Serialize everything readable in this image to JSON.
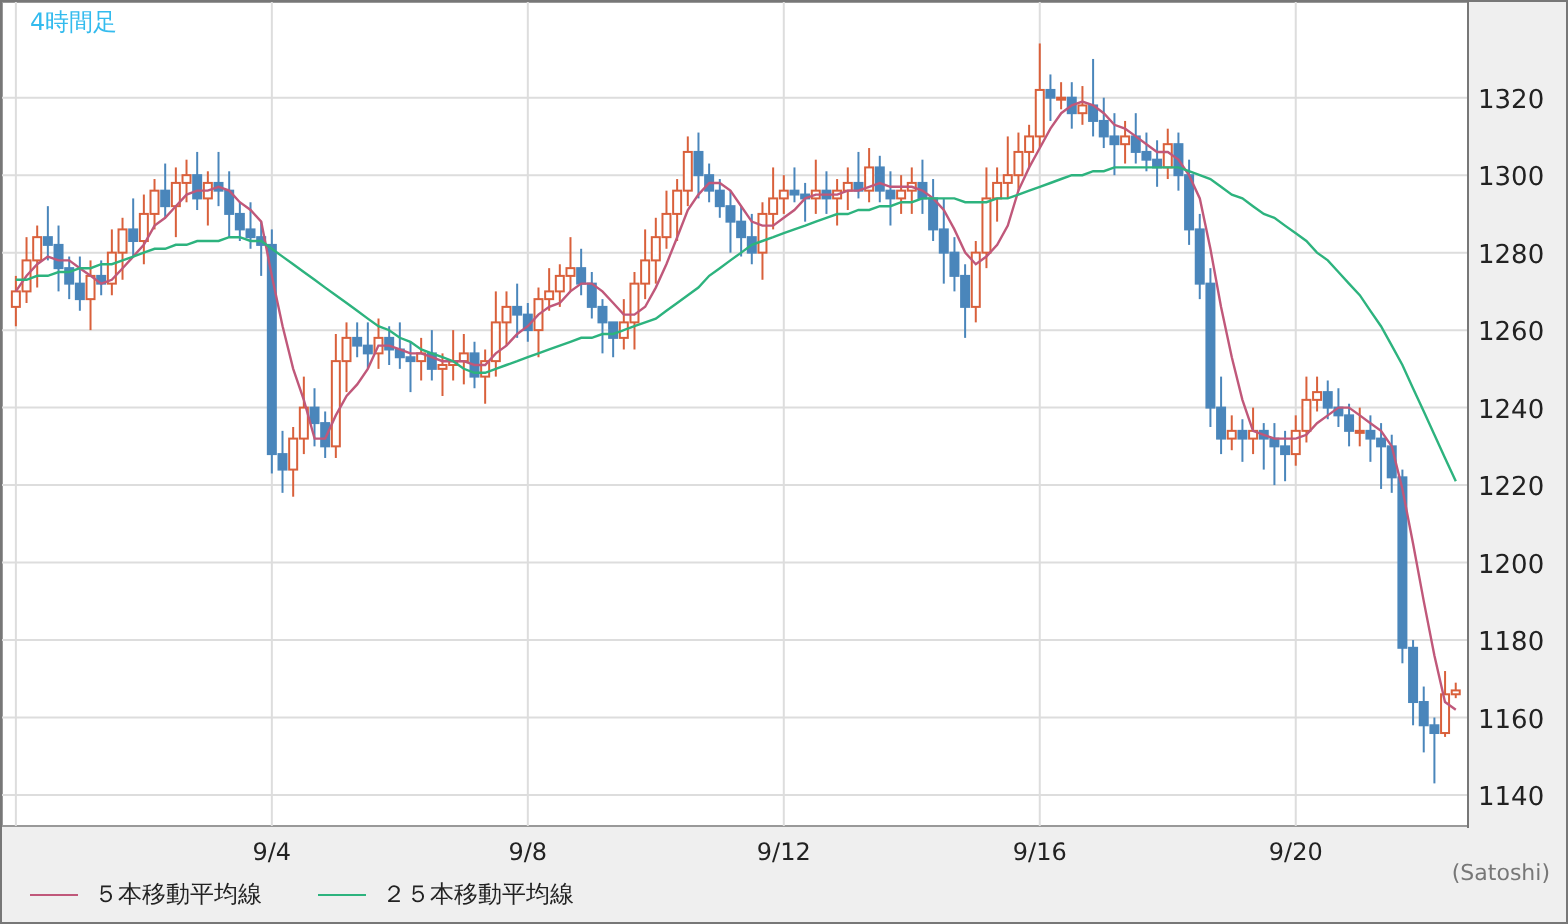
{
  "title": "4時間足",
  "chart_data": {
    "type": "candlestick",
    "grid": true,
    "ylim": [
      1132,
      1344.7
    ],
    "categories": [
      null,
      null,
      null,
      null,
      null,
      null,
      null,
      null,
      null,
      null,
      null,
      null,
      null,
      null,
      null,
      null,
      null,
      null,
      null,
      null,
      null,
      null,
      null,
      null,
      "9/4",
      null,
      null,
      null,
      null,
      null,
      null,
      null,
      null,
      null,
      null,
      null,
      null,
      null,
      null,
      null,
      null,
      null,
      null,
      null,
      null,
      null,
      null,
      null,
      "9/8",
      null,
      null,
      null,
      null,
      null,
      null,
      null,
      null,
      null,
      null,
      null,
      null,
      null,
      null,
      null,
      null,
      null,
      null,
      null,
      null,
      null,
      null,
      null,
      "9/12",
      null,
      null,
      null,
      null,
      null,
      null,
      null,
      null,
      null,
      null,
      null,
      null,
      null,
      null,
      null,
      null,
      null,
      null,
      null,
      null,
      null,
      null,
      null,
      "9/16",
      null,
      null,
      null,
      null,
      null,
      null,
      null,
      null,
      null,
      null,
      null,
      null,
      null,
      null,
      null,
      null,
      null,
      null,
      null,
      null,
      null,
      null,
      null,
      "9/20",
      null,
      null,
      null,
      null,
      null,
      null,
      null,
      null,
      null,
      null,
      null,
      null,
      null,
      null,
      null
    ],
    "yticks": [
      1140,
      1160,
      1180,
      1200,
      1220,
      1240,
      1260,
      1280,
      1300,
      1320
    ],
    "ohlc": [
      [
        1266,
        1274,
        1261,
        1270
      ],
      [
        1270,
        1284,
        1267,
        1278
      ],
      [
        1278,
        1287,
        1271,
        1284
      ],
      [
        1284,
        1292,
        1278,
        1282
      ],
      [
        1282,
        1287,
        1270,
        1276
      ],
      [
        1276,
        1279,
        1268,
        1272
      ],
      [
        1272,
        1279,
        1265,
        1268
      ],
      [
        1268,
        1278,
        1260,
        1274
      ],
      [
        1274,
        1278,
        1269,
        1272
      ],
      [
        1272,
        1286,
        1269,
        1280
      ],
      [
        1280,
        1289,
        1273,
        1286
      ],
      [
        1286,
        1294,
        1279,
        1283
      ],
      [
        1283,
        1295,
        1277,
        1290
      ],
      [
        1290,
        1299,
        1286,
        1296
      ],
      [
        1296,
        1303,
        1289,
        1292
      ],
      [
        1292,
        1302,
        1284,
        1298
      ],
      [
        1298,
        1304,
        1293,
        1300
      ],
      [
        1300,
        1306,
        1291,
        1294
      ],
      [
        1294,
        1301,
        1287,
        1298
      ],
      [
        1298,
        1306,
        1292,
        1296
      ],
      [
        1296,
        1301,
        1284,
        1290
      ],
      [
        1290,
        1293,
        1283,
        1286
      ],
      [
        1286,
        1293,
        1281,
        1284
      ],
      [
        1284,
        1288,
        1274,
        1282
      ],
      [
        1282,
        1286,
        1223,
        1228
      ],
      [
        1228,
        1234,
        1218,
        1224
      ],
      [
        1224,
        1235,
        1217,
        1232
      ],
      [
        1232,
        1248,
        1228,
        1240
      ],
      [
        1240,
        1245,
        1230,
        1236
      ],
      [
        1236,
        1239,
        1227,
        1230
      ],
      [
        1230,
        1259,
        1227,
        1252
      ],
      [
        1252,
        1262,
        1244,
        1258
      ],
      [
        1258,
        1262,
        1253,
        1256
      ],
      [
        1256,
        1262,
        1250,
        1254
      ],
      [
        1254,
        1263,
        1250,
        1258
      ],
      [
        1258,
        1261,
        1251,
        1255
      ],
      [
        1255,
        1262,
        1250,
        1253
      ],
      [
        1253,
        1257,
        1244,
        1252
      ],
      [
        1252,
        1258,
        1247,
        1254
      ],
      [
        1254,
        1260,
        1247,
        1250
      ],
      [
        1250,
        1254,
        1243,
        1251
      ],
      [
        1251,
        1260,
        1247,
        1252
      ],
      [
        1252,
        1259,
        1246,
        1254
      ],
      [
        1254,
        1257,
        1245,
        1248
      ],
      [
        1248,
        1255,
        1241,
        1252
      ],
      [
        1252,
        1270,
        1248,
        1262
      ],
      [
        1262,
        1270,
        1256,
        1266
      ],
      [
        1266,
        1272,
        1258,
        1264
      ],
      [
        1264,
        1267,
        1257,
        1260
      ],
      [
        1260,
        1271,
        1253,
        1268
      ],
      [
        1268,
        1276,
        1265,
        1270
      ],
      [
        1270,
        1277,
        1266,
        1274
      ],
      [
        1274,
        1284,
        1270,
        1276
      ],
      [
        1276,
        1281,
        1269,
        1272
      ],
      [
        1272,
        1275,
        1263,
        1266
      ],
      [
        1266,
        1268,
        1254,
        1262
      ],
      [
        1262,
        1262,
        1253,
        1258
      ],
      [
        1258,
        1268,
        1255,
        1262
      ],
      [
        1262,
        1275,
        1255,
        1272
      ],
      [
        1272,
        1286,
        1268,
        1278
      ],
      [
        1278,
        1289,
        1272,
        1284
      ],
      [
        1284,
        1296,
        1281,
        1290
      ],
      [
        1290,
        1299,
        1283,
        1296
      ],
      [
        1296,
        1310,
        1292,
        1306
      ],
      [
        1306,
        1311,
        1294,
        1300
      ],
      [
        1300,
        1303,
        1293,
        1296
      ],
      [
        1296,
        1299,
        1289,
        1292
      ],
      [
        1292,
        1296,
        1280,
        1288
      ],
      [
        1288,
        1292,
        1279,
        1284
      ],
      [
        1284,
        1290,
        1277,
        1280
      ],
      [
        1280,
        1293,
        1273,
        1290
      ],
      [
        1290,
        1302,
        1286,
        1294
      ],
      [
        1294,
        1300,
        1290,
        1296
      ],
      [
        1296,
        1302,
        1293,
        1295
      ],
      [
        1295,
        1298,
        1288,
        1294
      ],
      [
        1294,
        1304,
        1290,
        1296
      ],
      [
        1296,
        1301,
        1290,
        1294
      ],
      [
        1294,
        1299,
        1287,
        1296
      ],
      [
        1296,
        1302,
        1291,
        1298
      ],
      [
        1298,
        1306,
        1294,
        1296
      ],
      [
        1296,
        1307,
        1293,
        1302
      ],
      [
        1302,
        1305,
        1293,
        1296
      ],
      [
        1296,
        1301,
        1287,
        1294
      ],
      [
        1294,
        1300,
        1290,
        1296
      ],
      [
        1296,
        1302,
        1290,
        1298
      ],
      [
        1298,
        1304,
        1290,
        1294
      ],
      [
        1294,
        1299,
        1283,
        1286
      ],
      [
        1286,
        1294,
        1272,
        1280
      ],
      [
        1280,
        1284,
        1270,
        1274
      ],
      [
        1274,
        1277,
        1258,
        1266
      ],
      [
        1266,
        1283,
        1262,
        1280
      ],
      [
        1280,
        1302,
        1276,
        1294
      ],
      [
        1294,
        1302,
        1288,
        1298
      ],
      [
        1298,
        1310,
        1294,
        1300
      ],
      [
        1300,
        1311,
        1296,
        1306
      ],
      [
        1306,
        1313,
        1302,
        1310
      ],
      [
        1310,
        1334,
        1307,
        1322
      ],
      [
        1322,
        1326,
        1314,
        1320
      ],
      [
        1320,
        1324,
        1317,
        1320
      ],
      [
        1320,
        1324,
        1312,
        1316
      ],
      [
        1316,
        1323,
        1313,
        1318
      ],
      [
        1318,
        1330,
        1310,
        1314
      ],
      [
        1314,
        1320,
        1307,
        1310
      ],
      [
        1310,
        1316,
        1300,
        1308
      ],
      [
        1308,
        1314,
        1303,
        1310
      ],
      [
        1310,
        1316,
        1303,
        1306
      ],
      [
        1306,
        1311,
        1301,
        1304
      ],
      [
        1304,
        1309,
        1297,
        1302
      ],
      [
        1302,
        1312,
        1299,
        1308
      ],
      [
        1308,
        1311,
        1296,
        1300
      ],
      [
        1300,
        1304,
        1282,
        1286
      ],
      [
        1286,
        1290,
        1268,
        1272
      ],
      [
        1272,
        1276,
        1235,
        1240
      ],
      [
        1240,
        1248,
        1228,
        1232
      ],
      [
        1232,
        1238,
        1229,
        1234
      ],
      [
        1234,
        1237,
        1226,
        1232
      ],
      [
        1232,
        1240,
        1228,
        1234
      ],
      [
        1234,
        1236,
        1224,
        1232
      ],
      [
        1232,
        1236,
        1220,
        1230
      ],
      [
        1230,
        1234,
        1221,
        1228
      ],
      [
        1228,
        1238,
        1225,
        1234
      ],
      [
        1234,
        1248,
        1231,
        1242
      ],
      [
        1242,
        1248,
        1239,
        1244
      ],
      [
        1244,
        1247,
        1237,
        1240
      ],
      [
        1240,
        1245,
        1235,
        1238
      ],
      [
        1238,
        1241,
        1230,
        1234
      ],
      [
        1234,
        1240,
        1230,
        1234
      ],
      [
        1234,
        1238,
        1226,
        1232
      ],
      [
        1232,
        1236,
        1219,
        1230
      ],
      [
        1230,
        1233,
        1218,
        1222
      ],
      [
        1222,
        1224,
        1174,
        1178
      ],
      [
        1178,
        1180,
        1158,
        1164
      ],
      [
        1164,
        1168,
        1151,
        1158
      ],
      [
        1158,
        1160,
        1143,
        1156
      ],
      [
        1156,
        1172,
        1155,
        1166
      ],
      [
        1166,
        1169,
        1165,
        1167
      ]
    ],
    "series": [
      {
        "name": "５本移動平均線",
        "type": "line",
        "color": "#c0587a",
        "values": [
          1270,
          1274,
          1277,
          1279,
          1278,
          1278,
          1276,
          1274,
          1272,
          1273,
          1276,
          1279,
          1282,
          1287,
          1289,
          1292,
          1295,
          1296,
          1296,
          1297,
          1296,
          1293,
          1291,
          1288,
          1274,
          1261,
          1250,
          1242,
          1232,
          1232,
          1238,
          1243,
          1246,
          1250,
          1256,
          1256,
          1255,
          1254,
          1254,
          1253,
          1252,
          1252,
          1252,
          1251,
          1251,
          1254,
          1256,
          1259,
          1261,
          1264,
          1266,
          1267,
          1270,
          1272,
          1272,
          1270,
          1267,
          1264,
          1264,
          1266,
          1271,
          1277,
          1284,
          1291,
          1295,
          1298,
          1298,
          1296,
          1292,
          1288,
          1287,
          1287,
          1289,
          1291,
          1294,
          1295,
          1295,
          1295,
          1296,
          1296,
          1297,
          1298,
          1297,
          1297,
          1297,
          1296,
          1294,
          1291,
          1286,
          1280,
          1277,
          1279,
          1282,
          1287,
          1296,
          1302,
          1307,
          1312,
          1316,
          1318,
          1319,
          1318,
          1316,
          1313,
          1312,
          1310,
          1308,
          1306,
          1306,
          1304,
          1300,
          1294,
          1281,
          1266,
          1253,
          1242,
          1234,
          1233,
          1232,
          1232,
          1232,
          1233,
          1236,
          1238,
          1240,
          1240,
          1238,
          1236,
          1234,
          1230,
          1219,
          1205,
          1190,
          1176,
          1164,
          1162
        ]
      },
      {
        "name": "２５本移動平均線",
        "type": "line",
        "color": "#2db37e",
        "values": [
          1273,
          1273,
          1274,
          1274,
          1275,
          1275,
          1276,
          1276,
          1277,
          1277,
          1278,
          1279,
          1280,
          1281,
          1281,
          1282,
          1282,
          1283,
          1283,
          1283,
          1284,
          1284,
          1283,
          1283,
          1281,
          1279,
          1277,
          1275,
          1273,
          1271,
          1269,
          1267,
          1265,
          1263,
          1261,
          1260,
          1258,
          1257,
          1255,
          1254,
          1253,
          1252,
          1250,
          1249,
          1249,
          1250,
          1251,
          1252,
          1253,
          1254,
          1255,
          1256,
          1257,
          1258,
          1258,
          1259,
          1259,
          1260,
          1261,
          1262,
          1263,
          1265,
          1267,
          1269,
          1271,
          1274,
          1276,
          1278,
          1280,
          1282,
          1283,
          1284,
          1285,
          1286,
          1287,
          1288,
          1289,
          1290,
          1290,
          1291,
          1291,
          1292,
          1292,
          1293,
          1293,
          1294,
          1294,
          1294,
          1294,
          1293,
          1293,
          1293,
          1294,
          1294,
          1295,
          1296,
          1297,
          1298,
          1299,
          1300,
          1300,
          1301,
          1301,
          1302,
          1302,
          1302,
          1302,
          1302,
          1302,
          1302,
          1301,
          1300,
          1299,
          1297,
          1295,
          1294,
          1292,
          1290,
          1289,
          1287,
          1285,
          1283,
          1280,
          1278,
          1275,
          1272,
          1269,
          1265,
          1261,
          1256,
          1251,
          1245,
          1239,
          1233,
          1227,
          1221
        ]
      }
    ]
  },
  "unit": "(Satoshi)"
}
